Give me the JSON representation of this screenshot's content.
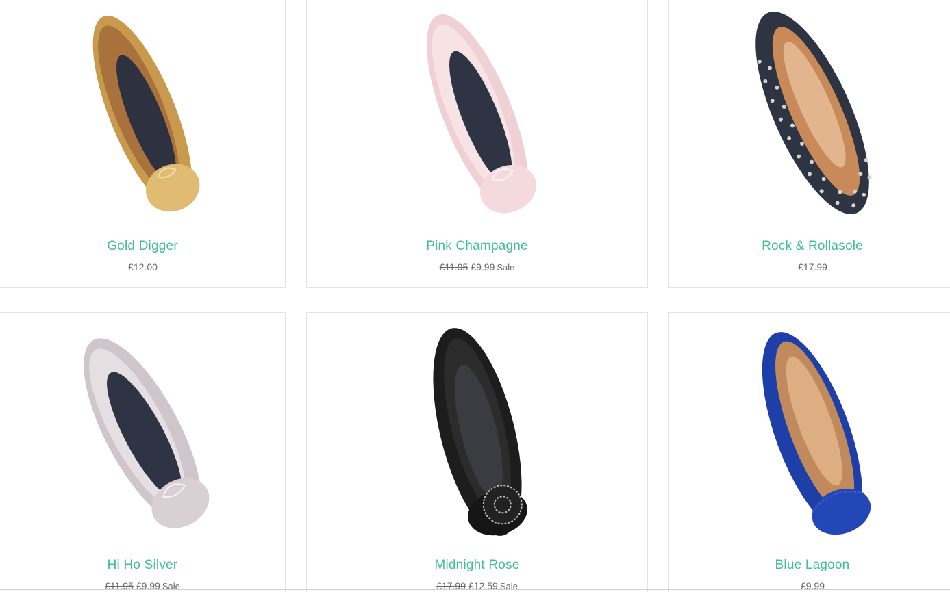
{
  "products": [
    {
      "name": "Gold Digger",
      "old_price": "",
      "price": "£12.00",
      "sale": "",
      "color": "#d4a75c",
      "icon": "ballet-flat-gold"
    },
    {
      "name": "Pink Champagne",
      "old_price": "£11.95",
      "price": "£9.99",
      "sale": "Sale",
      "color": "#f1d3d6",
      "icon": "ballet-flat-pink"
    },
    {
      "name": "Rock & Rollasole",
      "old_price": "",
      "price": "£17.99",
      "sale": "",
      "color": "#2f3442",
      "icon": "ballet-flat-studded"
    },
    {
      "name": "Hi Ho Silver",
      "old_price": "£11.95",
      "price": "£9.99",
      "sale": "Sale",
      "color": "#d8d0d4",
      "icon": "ballet-flat-silver"
    },
    {
      "name": "Midnight Rose",
      "old_price": "£17.99",
      "price": "£12.59",
      "sale": "Sale",
      "color": "#1f1f1f",
      "icon": "ballet-flat-black-rose"
    },
    {
      "name": "Blue Lagoon",
      "old_price": "",
      "price": "£9.99",
      "sale": "",
      "color": "#1f3fa8",
      "icon": "ballet-flat-blue"
    }
  ]
}
